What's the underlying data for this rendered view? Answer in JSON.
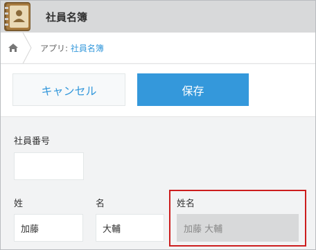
{
  "header": {
    "app_title": "社員名簿",
    "app_icon": "address-book-icon"
  },
  "breadcrumb": {
    "home_icon": "home-icon",
    "prefix": "アプリ: ",
    "app_link": "社員名簿"
  },
  "actions": {
    "cancel_label": "キャンセル",
    "save_label": "保存"
  },
  "form": {
    "employee_number": {
      "label": "社員番号",
      "value": ""
    },
    "last_name": {
      "label": "姓",
      "value": "加藤"
    },
    "first_name": {
      "label": "名",
      "value": "大輔"
    },
    "full_name": {
      "label": "姓名",
      "value": "加藤 大輔"
    }
  },
  "colors": {
    "accent": "#3498db",
    "highlight": "#cc1c1c",
    "header_bg": "#d8d9da"
  }
}
